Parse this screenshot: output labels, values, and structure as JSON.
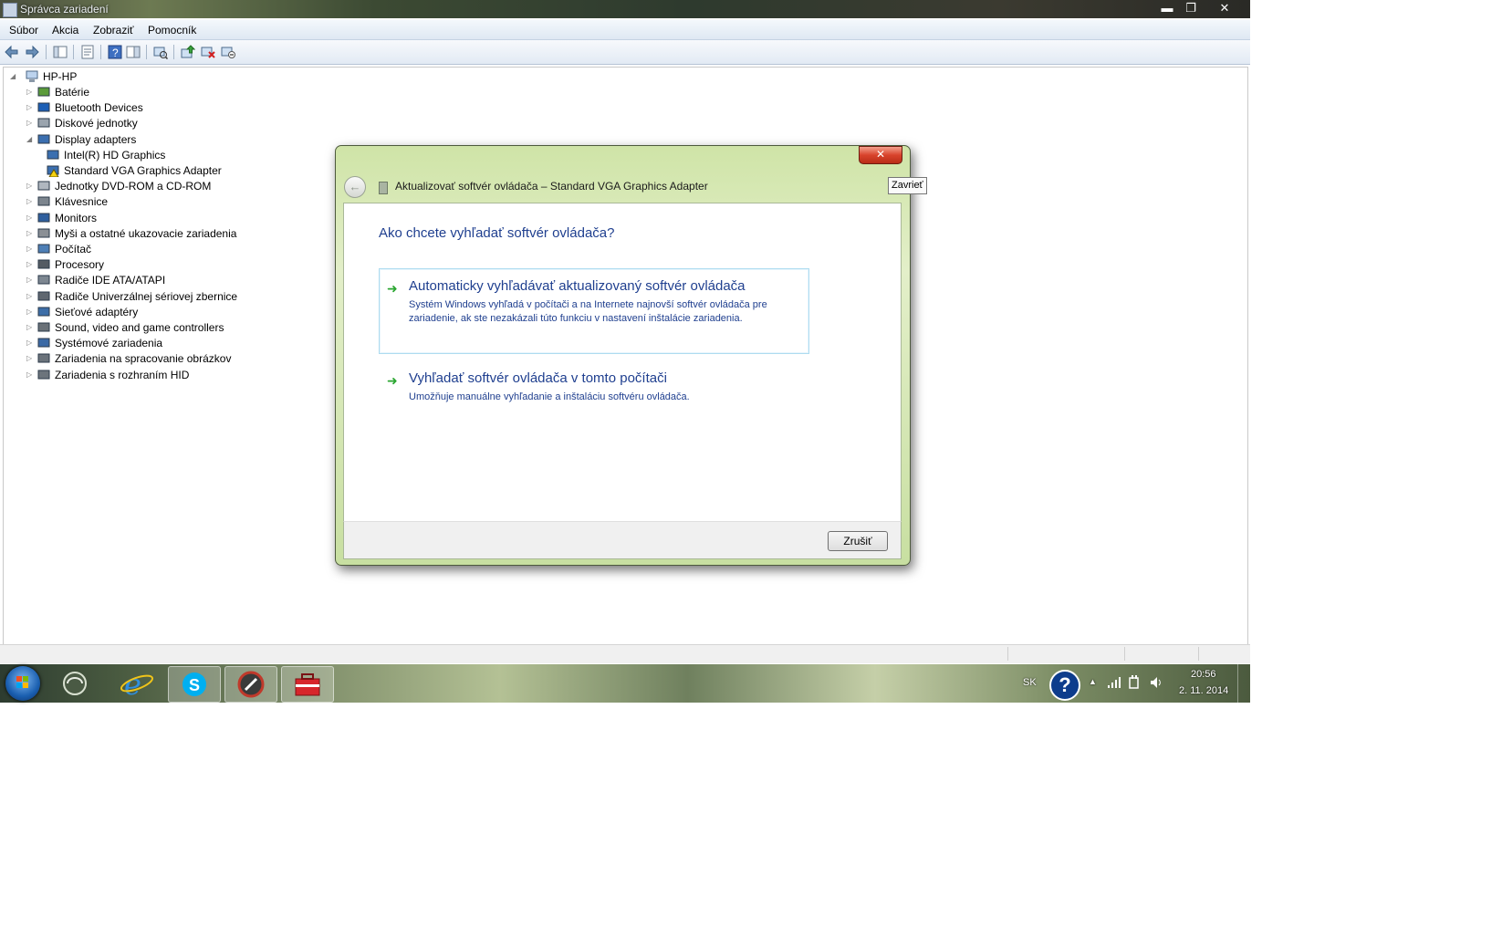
{
  "window": {
    "title": "Správca zariadení",
    "controls": {
      "minimize": "▬",
      "maximize": "❐",
      "close": "✕"
    }
  },
  "menu": [
    "Súbor",
    "Akcia",
    "Zobraziť",
    "Pomocník"
  ],
  "toolbar_icons": [
    "back-icon",
    "forward-icon",
    "show-hide-console-tree-icon",
    "properties-icon",
    "help-icon",
    "action-pane-icon",
    "scan-hardware-icon",
    "update-driver-icon",
    "uninstall-icon",
    "disable-icon"
  ],
  "tree": {
    "root": "HP-HP",
    "items": [
      {
        "label": "Batérie",
        "icon": "battery-icon",
        "expander": "▷"
      },
      {
        "label": "Bluetooth Devices",
        "icon": "bluetooth-icon",
        "expander": "▷"
      },
      {
        "label": "Diskové jednotky",
        "icon": "disk-icon",
        "expander": "▷"
      },
      {
        "label": "Display adapters",
        "icon": "display-adapter-icon",
        "expander": "◢"
      },
      {
        "label": "Intel(R) HD Graphics",
        "icon": "display-adapter-icon",
        "child": true
      },
      {
        "label": "Standard VGA Graphics Adapter",
        "icon": "warning-display-adapter-icon",
        "child": true
      },
      {
        "label": "Jednotky DVD-ROM a CD-ROM",
        "icon": "dvd-icon",
        "expander": "▷"
      },
      {
        "label": "Klávesnice",
        "icon": "keyboard-icon",
        "expander": "▷"
      },
      {
        "label": "Monitors",
        "icon": "monitor-icon",
        "expander": "▷"
      },
      {
        "label": "Myši a ostatné ukazovacie zariadenia",
        "icon": "mouse-icon",
        "expander": "▷"
      },
      {
        "label": "Počítač",
        "icon": "computer-icon",
        "expander": "▷"
      },
      {
        "label": "Procesory",
        "icon": "processor-icon",
        "expander": "▷"
      },
      {
        "label": "Radiče IDE ATA/ATAPI",
        "icon": "ide-controller-icon",
        "expander": "▷"
      },
      {
        "label": "Radiče Univerzálnej sériovej zbernice",
        "icon": "usb-icon",
        "expander": "▷"
      },
      {
        "label": "Sieťové adaptéry",
        "icon": "network-adapter-icon",
        "expander": "▷"
      },
      {
        "label": "Sound, video and game controllers",
        "icon": "sound-icon",
        "expander": "▷"
      },
      {
        "label": "Systémové zariadenia",
        "icon": "system-device-icon",
        "expander": "▷"
      },
      {
        "label": "Zariadenia na spracovanie obrázkov",
        "icon": "imaging-device-icon",
        "expander": "▷"
      },
      {
        "label": "Zariadenia s rozhraním HID",
        "icon": "hid-icon",
        "expander": "▷"
      }
    ]
  },
  "dialog": {
    "title": "Aktualizovať softvér ovládača – Standard VGA Graphics Adapter",
    "close_glyph": "✕",
    "back_glyph": "←",
    "question": "Ako chcete vyhľadať softvér ovládača?",
    "options": [
      {
        "title": "Automaticky vyhľadávať aktualizovaný softvér ovládača",
        "description": "Systém Windows vyhľadá v počítači a na Internete najnovší softvér ovládača pre zariadenie, ak ste nezakázali túto funkciu v nastavení inštalácie zariadenia."
      },
      {
        "title": "Vyhľadať softvér ovládača v tomto počítači",
        "description": "Umožňuje manuálne vyhľadanie a inštaláciu softvéru ovládača."
      }
    ],
    "arrow_glyph": "➜",
    "cancel_label": "Zrušiť"
  },
  "tooltip": "Zavrieť",
  "taskbar": {
    "apps": [
      "start-orb",
      "media-center",
      "internet-explorer",
      "skype",
      "opera-like-browser",
      "toolbox-app"
    ],
    "language": "SK",
    "help_glyph": "?",
    "show_hidden_glyph": "▲",
    "time": "20:56",
    "date": "2. 11. 2014"
  },
  "colors": {
    "accent_text": "#1f3f8f",
    "dialog_frame": "#cfe4a7",
    "close_red": "#d8432c",
    "option_border": "#aedcf0"
  }
}
